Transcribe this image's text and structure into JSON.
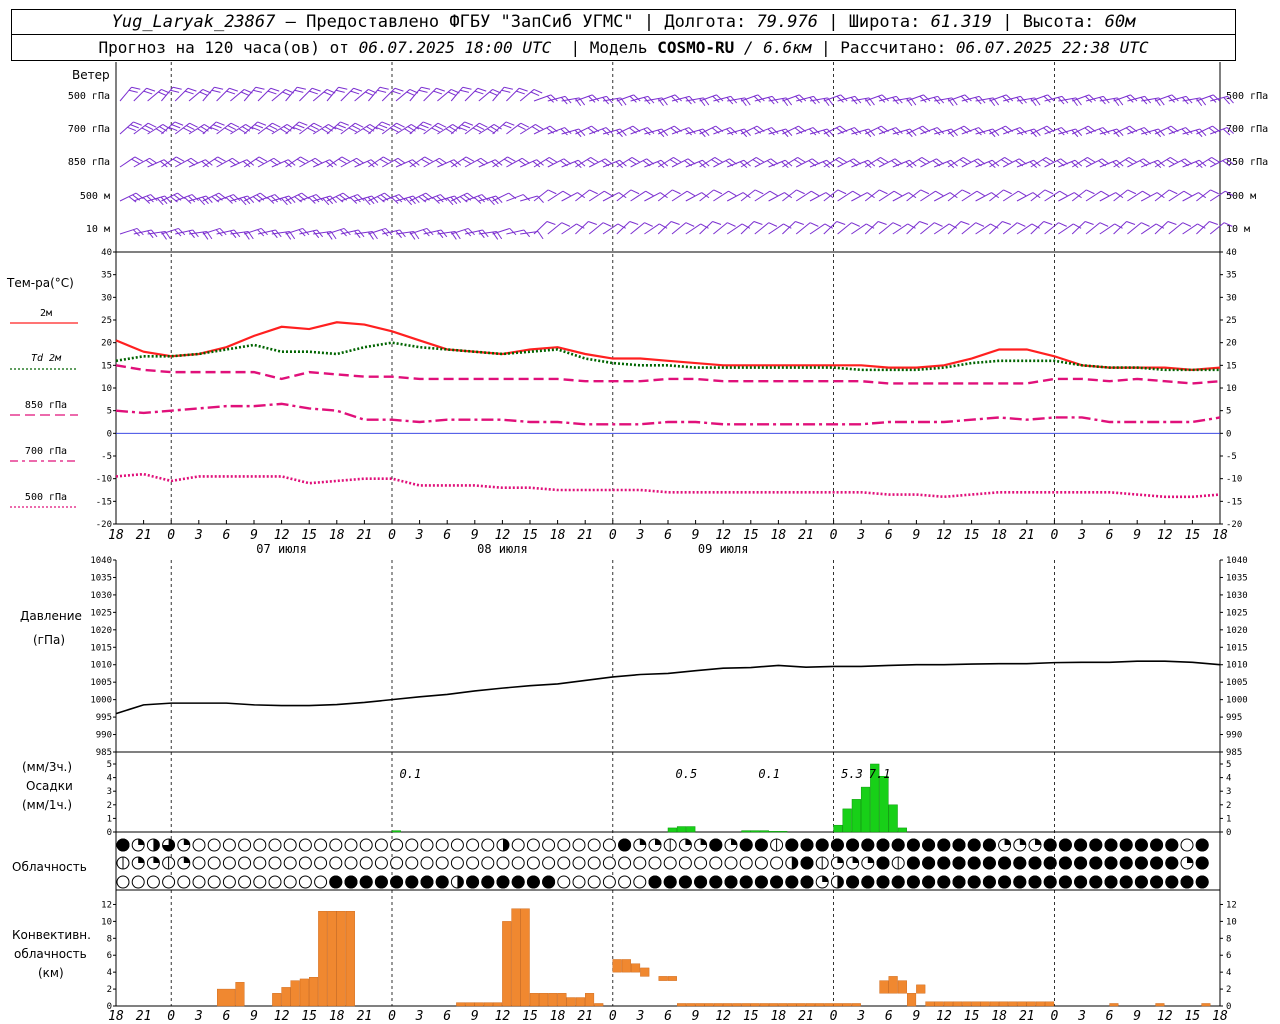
{
  "header": {
    "station": "Yug_Laryak_23867",
    "provider": "— Предоставлено ФГБУ \"ЗапСиб УГМС\"",
    "lon_label": "Долгота:",
    "lon_value": "79.976",
    "lat_label": "Широта:",
    "lat_value": "61.319",
    "alt_label": "Высота:",
    "alt_value": "60м",
    "sep": "|",
    "forecast_prefix": "Прогноз на 120 часа(ов) от",
    "forecast_start": "06.07.2025 18:00 UTC",
    "model_label": "Модель",
    "model_name": "COSMO-RU",
    "model_res": "/ 6.6км",
    "calc_label": "Рассчитано:",
    "calc_time": "06.07.2025 22:38 UTC"
  },
  "panels": {
    "wind": {
      "title": "Ветер",
      "levels": [
        "500 гПа",
        "700 гПа",
        "850 гПа",
        "500 м",
        "10 м"
      ]
    },
    "temperature": {
      "title": "Тем-ра(°C)",
      "legend": [
        {
          "label": "2м",
          "color": "#ff2020",
          "style": "solid"
        },
        {
          "label": "Td  2м",
          "color": "#006400",
          "style": "dotted"
        },
        {
          "label": "850 гПа",
          "color": "#e0107a",
          "style": "dash"
        },
        {
          "label": "700 гПа",
          "color": "#e0107a",
          "style": "dashdot"
        },
        {
          "label": "500 гПа",
          "color": "#e0107a",
          "style": "dotted"
        }
      ]
    },
    "pressure": {
      "title": "Давление",
      "unit": "(гПа)"
    },
    "precipitation": {
      "unit3h": "(мм/3ч.)",
      "title": "Осадки",
      "unit1h": "(мм/1ч.)"
    },
    "cloudiness": {
      "title": "Облачность"
    },
    "convective": {
      "title_1": "Конвективн.",
      "title_2": "облачность",
      "unit": "(км)"
    }
  },
  "chart_data": [
    {
      "type": "line",
      "title": "Тем-ра(°C)",
      "x_hours_from_start": [
        0,
        3,
        6,
        9,
        12,
        15,
        18,
        21,
        24,
        27,
        30,
        33,
        36,
        39,
        42,
        45,
        48,
        51,
        54,
        57,
        60,
        63,
        66,
        69,
        72,
        75,
        78,
        81,
        84,
        87,
        90,
        93,
        96,
        99,
        102,
        105,
        108,
        111,
        114,
        117,
        120
      ],
      "ylim": [
        -20,
        40
      ],
      "yticks": [
        -20,
        -15,
        -10,
        -5,
        0,
        5,
        10,
        15,
        20,
        25,
        30,
        35,
        40
      ],
      "series": [
        {
          "name": "2м",
          "color": "#ff2020",
          "style": "solid",
          "values": [
            20.5,
            18,
            17,
            17.5,
            19,
            21.5,
            23.5,
            23,
            24.5,
            24,
            22.5,
            20.5,
            18.5,
            18,
            17.5,
            18.5,
            19,
            17.5,
            16.5,
            16.5,
            16,
            15.5,
            15,
            15,
            15,
            15,
            15,
            15,
            14.5,
            14.5,
            15,
            16.5,
            18.5,
            18.5,
            17,
            15,
            14.5,
            14.5,
            14.5,
            14,
            14.5
          ]
        },
        {
          "name": "Td 2м",
          "color": "#006400",
          "style": "dotted",
          "values": [
            16,
            17,
            17,
            17.5,
            18.5,
            19.5,
            18,
            18,
            17.5,
            19,
            20,
            19,
            18.5,
            18,
            17.5,
            18,
            18.5,
            16.5,
            15.5,
            15,
            15,
            14.5,
            14.5,
            14.5,
            14.5,
            14.5,
            14.5,
            14,
            14,
            14,
            14.5,
            15.5,
            16,
            16,
            16,
            15,
            14.5,
            14.5,
            14,
            14,
            14
          ]
        },
        {
          "name": "850 гПа",
          "color": "#e0107a",
          "style": "dash",
          "values": [
            15,
            14,
            13.5,
            13.5,
            13.5,
            13.5,
            12,
            13.5,
            13,
            12.5,
            12.5,
            12,
            12,
            12,
            12,
            12,
            12,
            11.5,
            11.5,
            11.5,
            12,
            12,
            11.5,
            11.5,
            11.5,
            11.5,
            11.5,
            11.5,
            11,
            11,
            11,
            11,
            11,
            11,
            12,
            12,
            11.5,
            12,
            11.5,
            11,
            11.5
          ]
        },
        {
          "name": "700 гПа",
          "color": "#e0107a",
          "style": "dashdot",
          "values": [
            5,
            4.5,
            5,
            5.5,
            6,
            6,
            6.5,
            5.5,
            5,
            3,
            3,
            2.5,
            3,
            3,
            3,
            2.5,
            2.5,
            2,
            2,
            2,
            2.5,
            2.5,
            2,
            2,
            2,
            2,
            2,
            2,
            2.5,
            2.5,
            2.5,
            3,
            3.5,
            3,
            3.5,
            3.5,
            2.5,
            2.5,
            2.5,
            2.5,
            3.5
          ]
        },
        {
          "name": "500 гПа",
          "color": "#e0107a",
          "style": "dotted",
          "values": [
            -9.5,
            -9,
            -10.5,
            -9.5,
            -9.5,
            -9.5,
            -9.5,
            -11,
            -10.5,
            -10,
            -10,
            -11.5,
            -11.5,
            -11.5,
            -12,
            -12,
            -12.5,
            -12.5,
            -12.5,
            -12.5,
            -13,
            -13,
            -13,
            -13,
            -13,
            -13,
            -13,
            -13,
            -13.5,
            -13.5,
            -14,
            -13.5,
            -13,
            -13,
            -13,
            -13,
            -13,
            -13.5,
            -14,
            -14,
            -13.5
          ]
        }
      ]
    },
    {
      "type": "line",
      "title": "Давление",
      "ylabel": "(гПа)",
      "x_hours_from_start": [
        0,
        3,
        6,
        9,
        12,
        15,
        18,
        21,
        24,
        27,
        30,
        33,
        36,
        39,
        42,
        45,
        48,
        51,
        54,
        57,
        60,
        63,
        66,
        69,
        72,
        75,
        78,
        81,
        84,
        87,
        90,
        93,
        96,
        99,
        102,
        105,
        108,
        111,
        114,
        117,
        120
      ],
      "ylim": [
        985,
        1040
      ],
      "yticks": [
        985,
        990,
        995,
        1000,
        1005,
        1010,
        1015,
        1020,
        1025,
        1030,
        1035,
        1040
      ],
      "series": [
        {
          "name": "",
          "color": "#000000",
          "values": [
            996,
            998.5,
            999,
            999,
            999,
            998.5,
            998.3,
            998.3,
            998.6,
            999.2,
            1000,
            1000.8,
            1001.5,
            1002.5,
            1003.3,
            1004,
            1004.5,
            1005.5,
            1006.5,
            1007.2,
            1007.5,
            1008.3,
            1009,
            1009.2,
            1009.8,
            1009.3,
            1009.5,
            1009.5,
            1009.8,
            1010,
            1010,
            1010.2,
            1010.3,
            1010.3,
            1010.6,
            1010.7,
            1010.7,
            1011,
            1011,
            1010.7,
            1010
          ]
        }
      ]
    },
    {
      "type": "bar",
      "title": "Осадки",
      "ylabel": "(мм/1ч.)",
      "ylim": [
        0,
        5
      ],
      "yticks": [
        0,
        1,
        2,
        3,
        4,
        5
      ],
      "color": "#18d018",
      "bars_hours_from_start": [
        30,
        60,
        61,
        62,
        68,
        69,
        70,
        71,
        72,
        78,
        79,
        80,
        81,
        82,
        83,
        84,
        85
      ],
      "values": [
        0.1,
        0.3,
        0.4,
        0.4,
        0.1,
        0.1,
        0.1,
        0.05,
        0.05,
        0.5,
        1.7,
        2.4,
        3.3,
        5.0,
        4.1,
        2.0,
        0.3
      ],
      "labels_3h": [
        {
          "hour": 32,
          "text": "0.1"
        },
        {
          "hour": 62,
          "text": "0.5"
        },
        {
          "hour": 71,
          "text": "0.1"
        },
        {
          "hour": 80,
          "text": "5.3"
        },
        {
          "hour": 83,
          "text": "7.1"
        }
      ]
    },
    {
      "type": "bar",
      "title": "Конвективн. облачность",
      "ylabel": "(км)",
      "ylim": [
        0,
        13
      ],
      "yticks": [
        0,
        2,
        4,
        6,
        8,
        10,
        12
      ],
      "color": "#f08830",
      "segments_hours_from_start": [
        [
          11,
          13,
          2.0,
          0
        ],
        [
          13,
          14,
          2.8,
          0
        ],
        [
          17,
          18,
          1.5,
          0
        ],
        [
          18,
          19,
          2.2,
          0
        ],
        [
          19,
          20,
          3.0,
          0
        ],
        [
          20,
          21,
          3.2,
          0
        ],
        [
          21,
          22,
          3.4,
          0
        ],
        [
          22,
          23,
          11.2,
          0
        ],
        [
          23,
          24,
          11.2,
          0
        ],
        [
          24,
          25,
          11.2,
          0
        ],
        [
          25,
          26,
          11.2,
          0
        ],
        [
          37,
          38,
          0.4,
          0
        ],
        [
          38,
          39,
          0.4,
          0
        ],
        [
          39,
          40,
          0.4,
          0
        ],
        [
          40,
          41,
          0.4,
          0
        ],
        [
          41,
          42,
          0.4,
          0
        ],
        [
          42,
          43,
          10.0,
          0
        ],
        [
          43,
          44,
          11.5,
          0
        ],
        [
          44,
          45,
          11.5,
          0
        ],
        [
          45,
          46,
          1.5,
          0
        ],
        [
          46,
          47,
          1.5,
          0
        ],
        [
          47,
          48,
          1.5,
          0
        ],
        [
          48,
          49,
          1.5,
          0
        ],
        [
          49,
          50,
          1.0,
          0
        ],
        [
          50,
          51,
          1.0,
          0
        ],
        [
          51,
          52,
          1.5,
          0
        ],
        [
          52,
          53,
          0.3,
          0
        ],
        [
          54,
          55,
          5.5,
          4.0
        ],
        [
          55,
          56,
          5.5,
          4.0
        ],
        [
          56,
          57,
          5.0,
          4.0
        ],
        [
          57,
          58,
          4.5,
          3.5
        ],
        [
          59,
          60,
          3.5,
          3.0
        ],
        [
          60,
          61,
          3.5,
          3.0
        ],
        [
          61,
          62,
          0.3,
          0
        ],
        [
          62,
          63,
          0.3,
          0
        ],
        [
          63,
          64,
          0.3,
          0
        ],
        [
          64,
          65,
          0.3,
          0
        ],
        [
          65,
          66,
          0.3,
          0
        ],
        [
          66,
          67,
          0.3,
          0
        ],
        [
          67,
          68,
          0.3,
          0
        ],
        [
          68,
          69,
          0.3,
          0
        ],
        [
          69,
          70,
          0.3,
          0
        ],
        [
          70,
          71,
          0.3,
          0
        ],
        [
          71,
          72,
          0.3,
          0
        ],
        [
          72,
          73,
          0.3,
          0
        ],
        [
          73,
          74,
          0.3,
          0
        ],
        [
          74,
          75,
          0.3,
          0
        ],
        [
          75,
          76,
          0.3,
          0
        ],
        [
          76,
          77,
          0.3,
          0
        ],
        [
          77,
          78,
          0.3,
          0
        ],
        [
          78,
          79,
          0.3,
          0
        ],
        [
          79,
          80,
          0.3,
          0
        ],
        [
          80,
          81,
          0.3,
          0
        ],
        [
          83,
          84,
          3.0,
          1.5
        ],
        [
          84,
          85,
          3.5,
          1.5
        ],
        [
          85,
          86,
          3.0,
          1.5
        ],
        [
          86,
          87,
          1.5,
          0
        ],
        [
          87,
          88,
          2.5,
          1.5
        ],
        [
          88,
          89,
          0.5,
          0
        ],
        [
          89,
          90,
          0.5,
          0
        ],
        [
          90,
          91,
          0.5,
          0
        ],
        [
          91,
          92,
          0.5,
          0
        ],
        [
          92,
          93,
          0.5,
          0
        ],
        [
          93,
          94,
          0.5,
          0
        ],
        [
          94,
          95,
          0.5,
          0
        ],
        [
          95,
          96,
          0.5,
          0
        ],
        [
          96,
          97,
          0.5,
          0
        ],
        [
          97,
          98,
          0.5,
          0
        ],
        [
          98,
          99,
          0.5,
          0
        ],
        [
          99,
          100,
          0.5,
          0
        ],
        [
          100,
          101,
          0.5,
          0
        ],
        [
          101,
          102,
          0.5,
          0
        ],
        [
          108,
          109,
          0.3,
          0
        ],
        [
          113,
          114,
          0.3,
          0
        ],
        [
          118,
          119,
          0.3,
          0
        ]
      ]
    }
  ],
  "time_axis": {
    "start_hour": 18,
    "end_hour_offset": 120,
    "tick_labels": [
      "18",
      "21",
      "0",
      "3",
      "6",
      "9",
      "12",
      "15",
      "18",
      "21",
      "0",
      "3",
      "6",
      "9",
      "12",
      "15",
      "18",
      "21",
      "0",
      "3",
      "6",
      "9",
      "12",
      "15",
      "18",
      "21",
      "0",
      "3",
      "6",
      "9",
      "12",
      "15",
      "18",
      "21",
      "0",
      "3",
      "6",
      "9",
      "12",
      "15",
      "18",
      "21",
      "0"
    ],
    "day_labels": [
      "07 июля",
      "08 июля",
      "09 июля"
    ]
  },
  "cloud_rows": {
    "legend": "0=clear,1=1/4,2=1/2,3=3/4,4=overcast,5=half-vertical",
    "rows": [
      "41231000000000000000000002000000041151141445444444444444441114444444440440444244444414414111444444514414444445500000000000",
      "5115100000000000000000000000000000000000000024511145444444444444444444144441044444000000000000000000000000000000000000000",
      "0000000000000044444444244444400000044444444444124444444444444444444444444444444444000000000000000000000000000000000000000"
    ]
  }
}
